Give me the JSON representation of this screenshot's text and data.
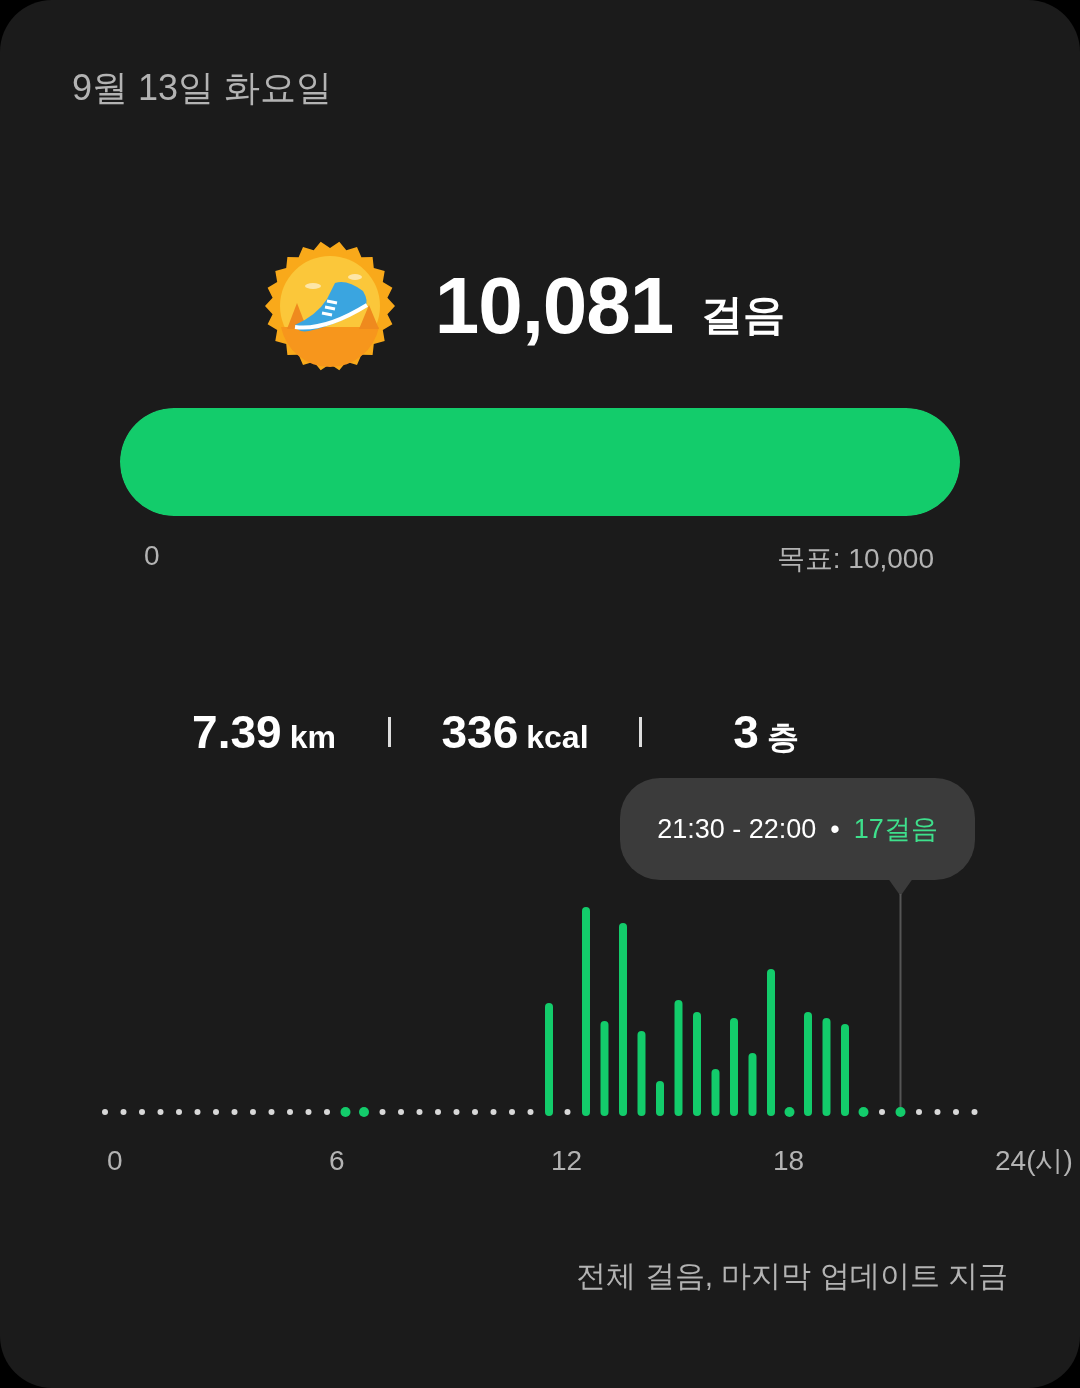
{
  "date": "9월 13일 화요일",
  "steps": {
    "count": "10,081",
    "unit": "걸음"
  },
  "goal": {
    "level": 1.0,
    "start": "0",
    "target": "목표: 10,000"
  },
  "stats": [
    {
      "value": "7.39",
      "unit": "km"
    },
    {
      "value": "336",
      "unit": "kcal"
    },
    {
      "value": "3",
      "unit": "층"
    }
  ],
  "chart": {
    "tooltip": {
      "time": "21:30 - 22:00",
      "separator": "•",
      "steps": "17걸음"
    },
    "x_labels": [
      "0",
      "6",
      "12",
      "18",
      "24(시)"
    ]
  },
  "footer": "전체 걸음, 마지막 업데이트 지금"
}
